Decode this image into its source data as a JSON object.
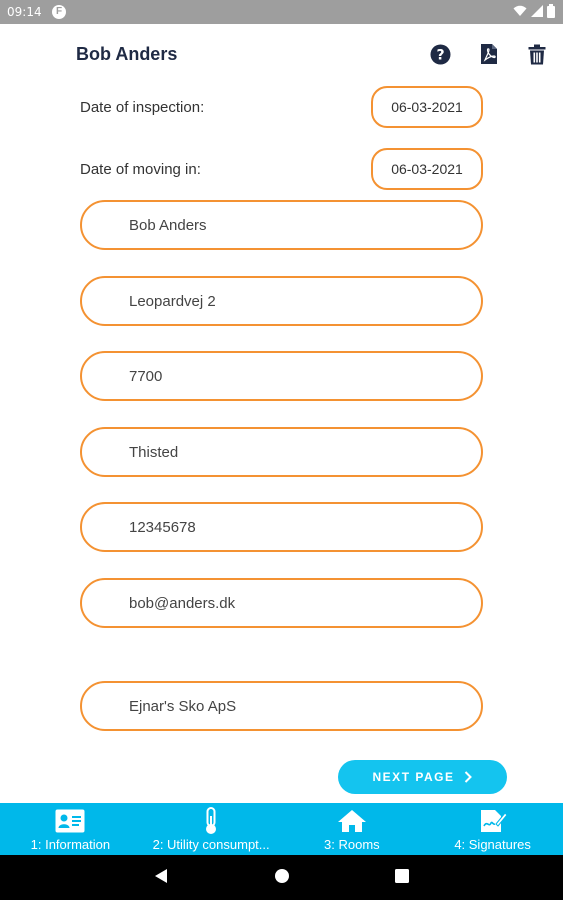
{
  "status_bar": {
    "time": "09:14",
    "app_icon": "F"
  },
  "header": {
    "title": "Bob Anders"
  },
  "dates": {
    "inspection_label": "Date of inspection:",
    "inspection_value": "06-03-2021",
    "moving_label": "Date of moving in:",
    "moving_value": "06-03-2021"
  },
  "fields": {
    "name": "Bob Anders",
    "address": "Leopardvej 2",
    "zip": "7700",
    "city": "Thisted",
    "phone": "12345678",
    "email": "bob@anders.dk",
    "company": "Ejnar's Sko ApS"
  },
  "next_button": {
    "label": "NEXT PAGE"
  },
  "bottom_nav": {
    "items": [
      {
        "label": "1: Information",
        "icon": "id-card-icon"
      },
      {
        "label": "2: Utility consumpt...",
        "icon": "thermometer-icon"
      },
      {
        "label": "3: Rooms",
        "icon": "home-icon"
      },
      {
        "label": "4: Signatures",
        "icon": "signature-icon"
      }
    ]
  },
  "colors": {
    "accent_orange": "#f49232",
    "primary_blue": "#00b8ea",
    "header_text": "#1f2a44"
  }
}
